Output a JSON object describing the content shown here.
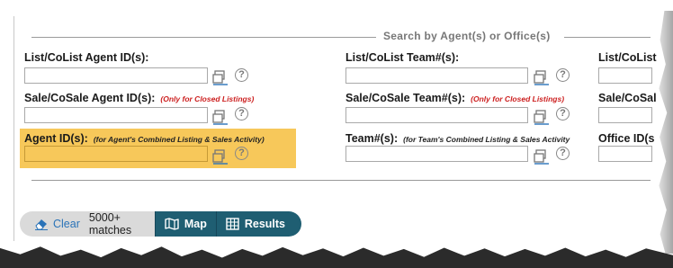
{
  "section": {
    "legend": "Search by Agent(s) or Office(s)"
  },
  "fields": {
    "list_agent_label": "List/CoList Agent ID(s):",
    "list_team_label": "List/CoList Team#(s):",
    "list_office_label": "List/CoList",
    "sale_agent_label": "Sale/CoSale Agent ID(s):",
    "sale_agent_note": "(Only for Closed Listings)",
    "sale_team_label": "Sale/CoSale Team#(s):",
    "sale_team_note": "(Only for Closed Listings)",
    "sale_office_label": "Sale/CoSal",
    "agent_label": "Agent ID(s):",
    "agent_note": "(for Agent's Combined Listing & Sales Activity)",
    "team_label": "Team#(s):",
    "team_note": "(for Team's Combined Listing & Sales Activity",
    "office_label": "Office ID(s"
  },
  "help_symbol": "?",
  "toolbar": {
    "clear_label": "Clear",
    "matches": "5000+ matches",
    "map_label": "Map",
    "results_label": "Results"
  },
  "colors": {
    "highlight": "#f7c85a",
    "toolbar_dark": "#1f5e72",
    "link": "#2a73b8",
    "note_red": "#cc1f1f"
  },
  "icons": [
    "picker-icon",
    "help-icon",
    "eraser-icon",
    "map-icon",
    "grid-icon"
  ]
}
